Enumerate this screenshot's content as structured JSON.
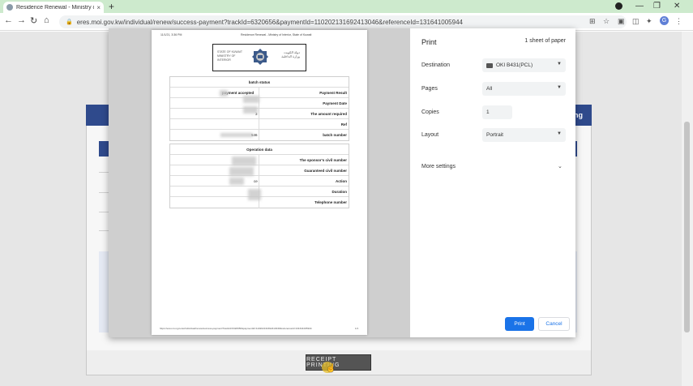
{
  "browser": {
    "tab_title": "Residence Renewal - Ministry of",
    "tab_close": "×",
    "new_tab": "+",
    "url": "eres.moi.gov.kw/individual/renew/success-payment?trackId=6320656&paymentId=110202131692413046&referenceId=131641005944",
    "window_minimize": "—",
    "window_maximize": "❐",
    "window_close": "✕",
    "profile_initial": "G"
  },
  "page": {
    "card_header_fragment": "ng",
    "receipt_button": "RECEIPT PRINTING"
  },
  "preview": {
    "print_date": "11/1/21, 3:36 PM",
    "print_header": "Residence Renewal - Ministry of Interior, State of Kuwait",
    "logo_en_line1": "STATE OF KUWAIT",
    "logo_en_line2": "MINISTRY OF INTERIOR",
    "logo_ar_line1": "دولة الكويت",
    "logo_ar_line2": "وزارة الداخلية",
    "batch_status_title": "batch status",
    "payment_result_value": "payment accepted",
    "amount_value": "3",
    "batch_number_value": "546",
    "operation_data_title": "Operation data",
    "action_value": "ce",
    "rows_batch": [
      {
        "label": "Payment Result"
      },
      {
        "label": "Payment Date"
      },
      {
        "label": "The amount required"
      },
      {
        "label": "Ref"
      },
      {
        "label": "batch number"
      }
    ],
    "rows_operation": [
      {
        "label": "The sponsor's civil number"
      },
      {
        "label": "Guaranteed civil number"
      },
      {
        "label": "Action"
      },
      {
        "label": "Duration"
      },
      {
        "label": "Telephone number"
      }
    ],
    "footer_url": "https://eres.moi.gov.kw/individual/renew/success-payment?trackId=6320656&paymentId=110202131692413046&referenceId=131641005944",
    "footer_page": "1/1"
  },
  "print_settings": {
    "title": "Print",
    "sheet_count": "1 sheet of paper",
    "destination_label": "Destination",
    "destination_value": "OKI B431(PCL)",
    "pages_label": "Pages",
    "pages_value": "All",
    "copies_label": "Copies",
    "copies_value": "1",
    "layout_label": "Layout",
    "layout_value": "Portrait",
    "more_settings": "More settings",
    "print_button": "Print",
    "cancel_button": "Cancel"
  },
  "colors": {
    "tabstrip": "#cdeacd",
    "site_header": "#2f4a8c",
    "print_button": "#1a73e8"
  }
}
